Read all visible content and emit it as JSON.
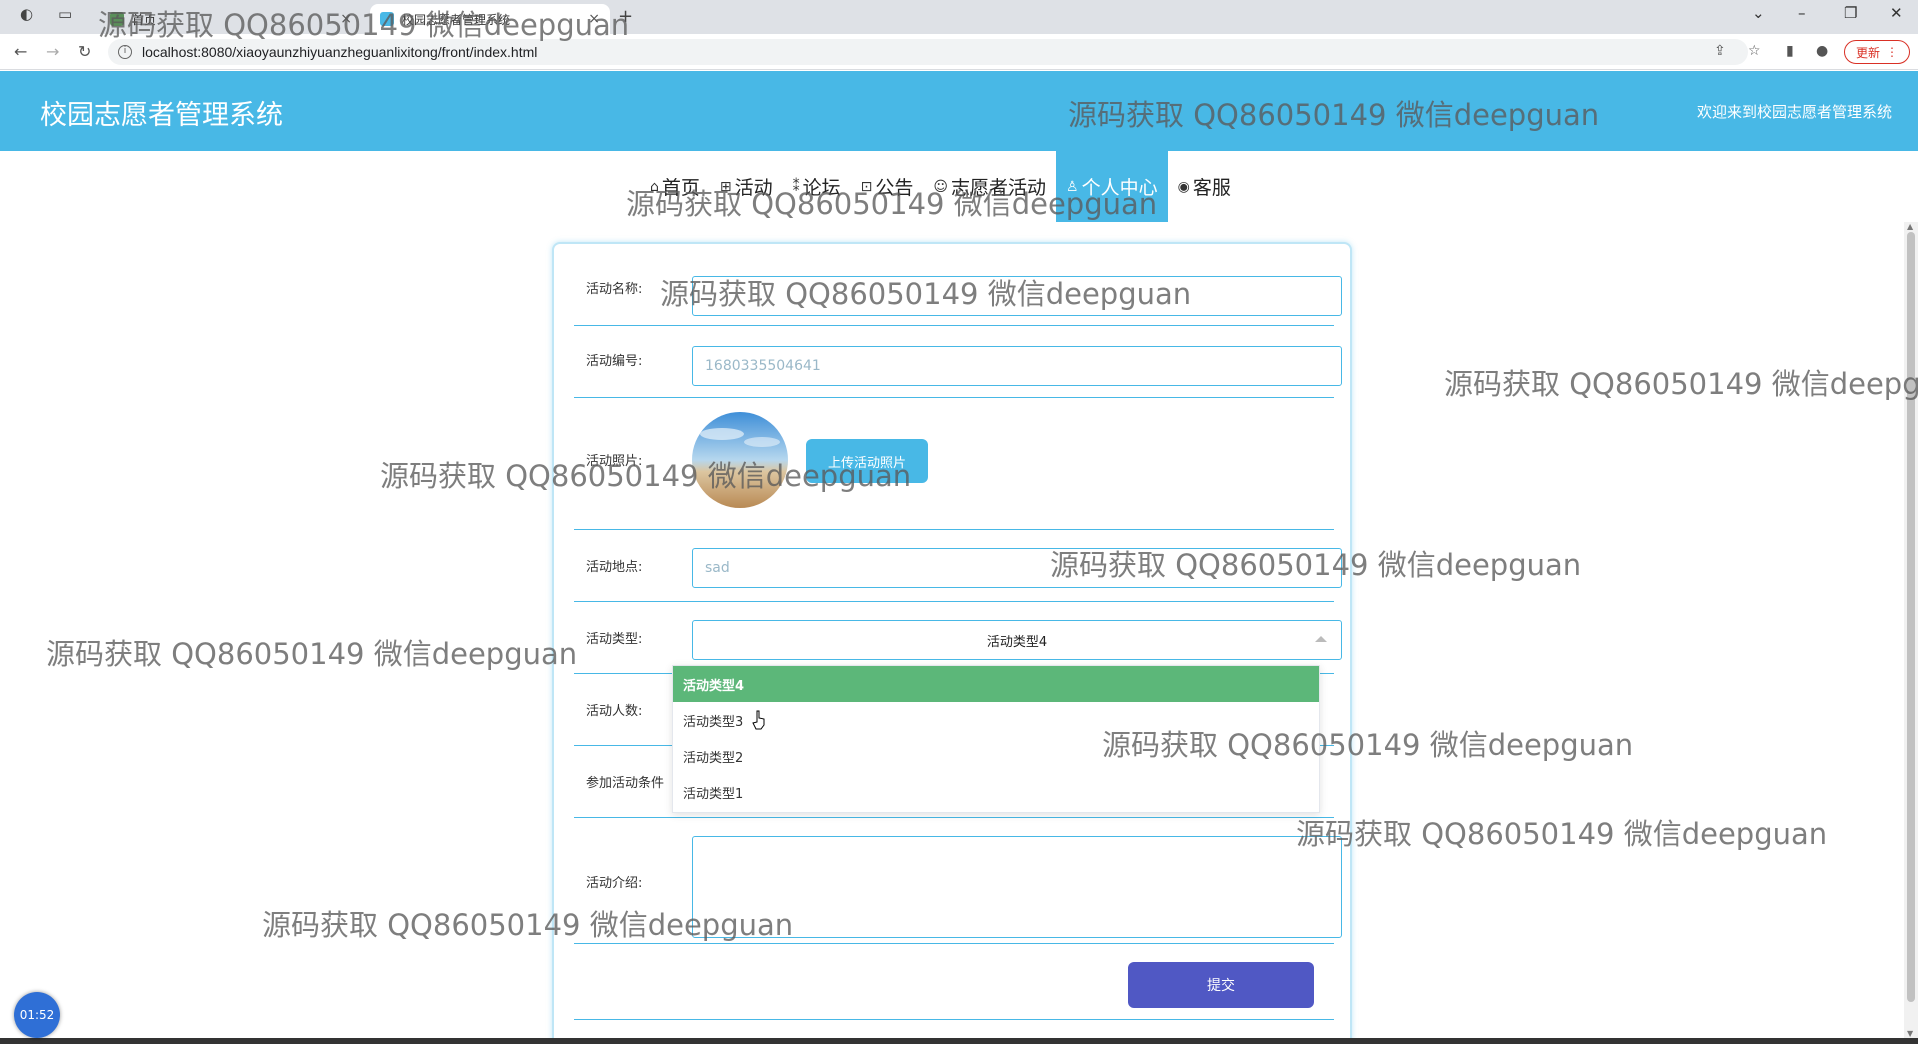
{
  "browser": {
    "tabs": [
      {
        "title": "首页",
        "close": "×"
      },
      {
        "title": "校园志愿者管理系统",
        "close": "×"
      }
    ],
    "new_tab": "+",
    "url": "localhost:8080/xiaoyaunzhiyuanzheguanlixitong/front/index.html",
    "update_label": "更新",
    "update_menu": "⋮"
  },
  "site": {
    "title": "校园志愿者管理系统",
    "welcome": "欢迎来到校园志愿者管理系统"
  },
  "nav": {
    "items": [
      {
        "icon": "⌂",
        "label": "首页"
      },
      {
        "icon": "⊞",
        "label": "活动"
      },
      {
        "icon": "⁑",
        "label": "论坛"
      },
      {
        "icon": "⊡",
        "label": "公告"
      },
      {
        "icon": "☺",
        "label": "志愿者活动"
      },
      {
        "icon": "♙",
        "label": "个人中心"
      },
      {
        "icon": "◉",
        "label": "客服"
      }
    ],
    "active": "个人中心"
  },
  "form": {
    "name_label": "活动名称:",
    "name_value": "",
    "code_label": "活动编号:",
    "code_value": "1680335504641",
    "photo_label": "活动照片:",
    "upload_label": "上传活动照片",
    "place_label": "活动地点:",
    "place_value": "sad",
    "type_label": "活动类型:",
    "type_value": "活动类型4",
    "count_label": "活动人数:",
    "condition_label": "参加活动条件",
    "intro_label": "活动介绍:",
    "submit_label": "提交"
  },
  "dropdown": {
    "options": [
      "活动类型4",
      "活动类型3",
      "活动类型2",
      "活动类型1"
    ],
    "selected": "活动类型4"
  },
  "timer": "01:52",
  "watermark": "源码获取 QQ86050149 微信deepguan",
  "colors": {
    "brand": "#48b8e6",
    "selected_option": "#5cb779",
    "submit": "#5058c4"
  }
}
